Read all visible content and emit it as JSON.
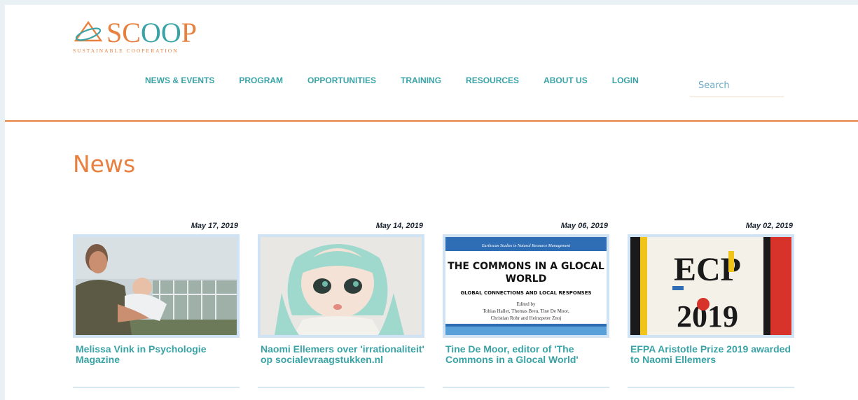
{
  "brand": {
    "name_left": "SC",
    "name_oo": "OO",
    "name_right": "P",
    "tagline": "SUSTAINABLE COOPERATION",
    "colors": {
      "orange": "#e8803f",
      "teal": "#3aa3a6"
    }
  },
  "nav": {
    "items": [
      {
        "label": "NEWS & EVENTS"
      },
      {
        "label": "PROGRAM"
      },
      {
        "label": "OPPORTUNITIES"
      },
      {
        "label": "TRAINING"
      },
      {
        "label": "RESOURCES"
      },
      {
        "label": "ABOUT US"
      },
      {
        "label": "LOGIN"
      }
    ]
  },
  "search": {
    "placeholder": "Search"
  },
  "main": {
    "title": "News",
    "cards": [
      {
        "date": "May 17, 2019",
        "title": "Melissa Vink in Psychologie Magazine"
      },
      {
        "date": "May 14, 2019",
        "title": "Naomi Ellemers over 'irrationaliteit' op socialevraagstukken.nl"
      },
      {
        "date": "May 06, 2019",
        "title": "Tine De Moor, editor of 'The Commons in a Glocal World'",
        "image": {
          "series": "Earthscan Studies in Natural Resource Management",
          "heading": "THE COMMONS IN A GLOCAL WORLD",
          "subtitle": "GLOBAL CONNECTIONS AND LOCAL RESPONSES",
          "edited_by": "Edited by",
          "editors_1": "Tobias Haller, Thomas Breu, Tine De Moor,",
          "editors_2": "Christian Rohr and Heinzpeter Znoj"
        }
      },
      {
        "date": "May 02, 2019",
        "title": "EFPA Aristotle Prize 2019 awarded to Naomi Ellemers",
        "image": {
          "text_top": "ECP",
          "text_bottom": "2019"
        }
      }
    ]
  }
}
